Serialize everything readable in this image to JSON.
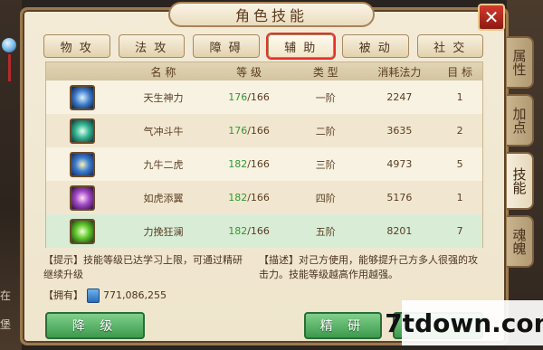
{
  "window": {
    "title": "角色技能",
    "close_label": "✕"
  },
  "side_tabs": [
    {
      "label": "属性",
      "active": false
    },
    {
      "label": "加点",
      "active": false
    },
    {
      "label": "技能",
      "active": true
    },
    {
      "label": "魂魄",
      "active": false
    }
  ],
  "categories": [
    {
      "label": "物 攻",
      "active": false
    },
    {
      "label": "法 攻",
      "active": false
    },
    {
      "label": "障 碍",
      "active": false
    },
    {
      "label": "辅 助",
      "active": true
    },
    {
      "label": "被 动",
      "active": false
    },
    {
      "label": "社 交",
      "active": false
    }
  ],
  "table": {
    "headers": {
      "name": "名 称",
      "level": "等 级",
      "type": "类 型",
      "cost": "消耗法力",
      "target": "目 标"
    },
    "rows": [
      {
        "icon": "blue-spirit-skill-icon",
        "name": "天生神力",
        "level_cur": "176",
        "level_max": "/166",
        "type": "一阶",
        "cost": "2247",
        "target": "1"
      },
      {
        "icon": "teal-aura-skill-icon",
        "name": "气冲斗牛",
        "level_cur": "176",
        "level_max": "/166",
        "type": "二阶",
        "cost": "3635",
        "target": "2"
      },
      {
        "icon": "golden-flame-skill-icon",
        "name": "九牛二虎",
        "level_cur": "182",
        "level_max": "/166",
        "type": "三阶",
        "cost": "4973",
        "target": "5"
      },
      {
        "icon": "purple-vortex-skill-icon",
        "name": "如虎添翼",
        "level_cur": "182",
        "level_max": "/166",
        "type": "四阶",
        "cost": "5176",
        "target": "1"
      },
      {
        "icon": "green-burst-skill-icon",
        "name": "力挽狂澜",
        "level_cur": "182",
        "level_max": "/166",
        "type": "五阶",
        "cost": "8201",
        "target": "7"
      }
    ]
  },
  "tip": "【提示】技能等级已达学习上限，可通过精研继续升级",
  "desc": "【描述】对己方使用，能够提升己方多人很强的攻击力。技能等级越高作用越强。",
  "own": {
    "label": "【拥有】",
    "value": "771,086,255"
  },
  "buttons": {
    "downgrade": "降 级",
    "refine": "精 研",
    "hidden": ""
  },
  "left_edge_text": [
    "在",
    "堡"
  ],
  "watermark": "7tdown.com"
}
